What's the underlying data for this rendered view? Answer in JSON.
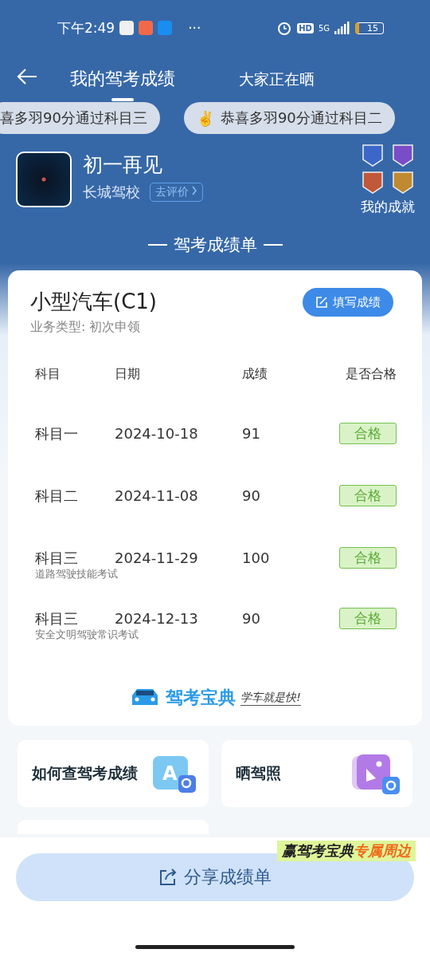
{
  "status_bar": {
    "time": "下午2:49",
    "more": "···",
    "network": "5G",
    "hd": "HD",
    "battery": "15"
  },
  "header": {
    "tabs": [
      {
        "label": "我的驾考成绩",
        "selected": true
      },
      {
        "label": "大家正在晒",
        "selected": false
      }
    ]
  },
  "tickers": [
    {
      "text": "喜多羽90分通过科目三"
    },
    {
      "emoji": "✌️",
      "text": "恭喜多羽90分通过科目二"
    }
  ],
  "profile": {
    "name": "初一再见",
    "school": "长城驾校",
    "review_button": "去评价",
    "achievements_label": "我的成就"
  },
  "section_title": "驾考成绩单",
  "report": {
    "vehicle": "小型汽车(C1)",
    "business_type": "业务类型: 初次申领",
    "fill_button": "填写成绩",
    "columns": [
      "科目",
      "日期",
      "成绩",
      "是否合格"
    ],
    "rows": [
      {
        "subject": "科目一",
        "date": "2024-10-18",
        "score": "91",
        "result": "合格",
        "passed": true
      },
      {
        "subject": "科目二",
        "date": "2024-11-08",
        "score": "90",
        "result": "合格",
        "passed": true
      },
      {
        "subject": "科目三",
        "date": "2024-11-29",
        "score": "100",
        "result": "合格",
        "passed": true,
        "note": "道路驾驶技能考试"
      },
      {
        "subject": "科目三",
        "date": "2024-12-13",
        "score": "90",
        "result": "合格",
        "passed": true,
        "note": "安全文明驾驶常识考试"
      }
    ],
    "brand": "驾考宝典",
    "slogan": "学车就是快!"
  },
  "tiles": [
    {
      "label": "如何查驾考成绩",
      "kind": "search",
      "icon_letter": "A"
    },
    {
      "label": "晒驾照",
      "kind": "photo"
    }
  ],
  "promo": {
    "prefix": "赢驾考宝典",
    "highlight": "专属周边"
  },
  "share_button": "分享成绩单"
}
